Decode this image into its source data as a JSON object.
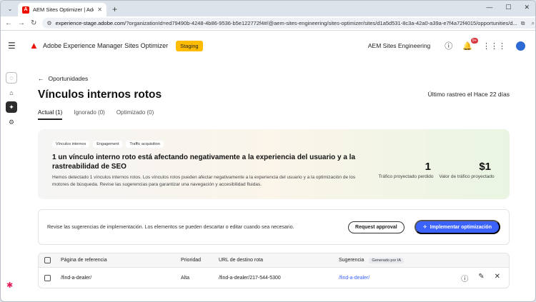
{
  "browser": {
    "tab_title": "AEM Sites Optimizer | Adobe E",
    "url_host": "experience-stage.adobe.com",
    "url_path": "/?organizationId=ed79490b-4248-4b86-9536-b5e122772f4#/@aem-sites-engineering/sites-optimizer/sites/d1a5d531-8c3a-42a0-a39a-e7f4a72f4015/opportunities/d..."
  },
  "header": {
    "app_name": "Adobe Experience Manager Sites Optimizer",
    "env_badge": "Staging",
    "org_name": "AEM Sites Engineering",
    "notification_count": "9+"
  },
  "page": {
    "back_label": "Oportunidades",
    "title": "Vínculos internos rotos",
    "last_scan": "Último rastreo el Hace 22 días",
    "tabs": [
      {
        "label": "Actual (1)"
      },
      {
        "label": "Ignorado (0)"
      },
      {
        "label": "Optimizado (0)"
      }
    ]
  },
  "hero": {
    "chips": [
      "Vínculos internos",
      "Engagement",
      "Traffic acquisition"
    ],
    "headline": "1 un vínculo interno roto está afectando negativamente a la experiencia del usuario y a la rastreabilidad de SEO",
    "description": "Hemos detectado 1 vínculos internos rotos. Los vínculos rotos pueden afectar negativamente a la experiencia del usuario y a la optimización de los motores de búsqueda. Revise las sugerencias para garantizar una navegación y accesibilidad fluidas.",
    "metrics": [
      {
        "value": "1",
        "label": "Tráfico proyectado perdido"
      },
      {
        "value": "$1",
        "label": "Valor de tráfico proyectado"
      }
    ]
  },
  "actions": {
    "text": "Revise las sugerencias de implementación. Los elementos se pueden descartar o editar cuando sea necesario.",
    "request_label": "Request approval",
    "implement_label": "Implementar optimización"
  },
  "table": {
    "headers": {
      "reference": "Página de referencia",
      "priority": "Prioridad",
      "target": "URL de destino rota",
      "suggestion": "Sugerencia",
      "ai_badge": "Generado por IA"
    },
    "rows": [
      {
        "reference": "/find-a-dealer/",
        "priority": "Alta",
        "target": "/find-a-dealer/217-544-5300",
        "suggestion": "/find-a-dealer/"
      }
    ]
  }
}
